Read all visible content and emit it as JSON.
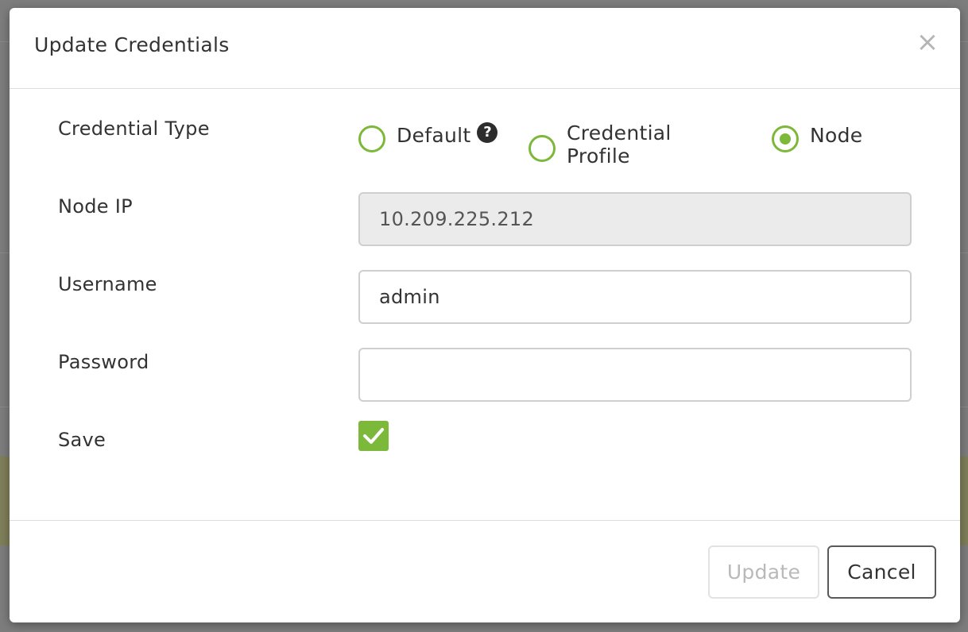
{
  "dialog": {
    "title": "Update Credentials",
    "close_label": "×"
  },
  "form": {
    "credential_type": {
      "label": "Credential Type",
      "options": [
        {
          "label": "Default",
          "checked": false,
          "help_icon": "question-circle-icon"
        },
        {
          "label": "Credential Profile",
          "checked": false
        },
        {
          "label": "Node",
          "checked": true
        }
      ]
    },
    "node_ip": {
      "label": "Node IP",
      "value": "10.209.225.212",
      "disabled": true
    },
    "username": {
      "label": "Username",
      "value": "admin"
    },
    "password": {
      "label": "Password",
      "value": ""
    },
    "save": {
      "label": "Save",
      "checked": true
    }
  },
  "footer": {
    "update_label": "Update",
    "cancel_label": "Cancel"
  },
  "colors": {
    "accent": "#7cb839",
    "backdrop": "#7d7d7d"
  }
}
